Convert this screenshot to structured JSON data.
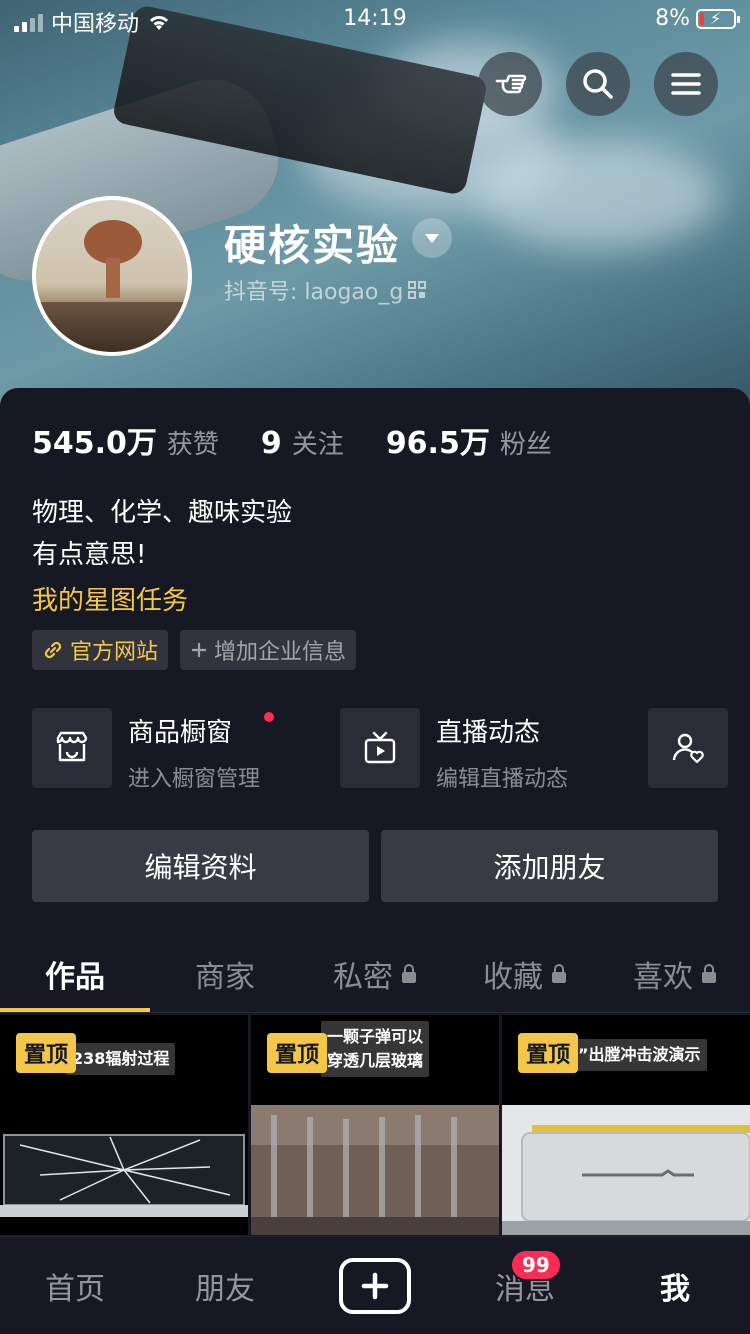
{
  "status_bar": {
    "carrier": "中国移动",
    "time": "14:19",
    "battery": "8%"
  },
  "profile": {
    "name": "硬核实验",
    "douyin_id": "抖音号: laogao_g",
    "stats": [
      {
        "num": "545.0万",
        "label": "获赞"
      },
      {
        "num": "9",
        "label": "关注"
      },
      {
        "num": "96.5万",
        "label": "粉丝"
      }
    ],
    "bio_line1": "物理、化学、趣味实验",
    "bio_line2": "有点意思!",
    "star_task": "我的星图任务",
    "tag_official": "官方网站",
    "tag_add": "增加企业信息"
  },
  "tools": [
    {
      "title": "商品橱窗",
      "sub": "进入橱窗管理"
    },
    {
      "title": "直播动态",
      "sub": "编辑直播动态"
    }
  ],
  "actions": {
    "edit": "编辑资料",
    "add_friend": "添加朋友"
  },
  "tabs": [
    "作品",
    "商家",
    "私密",
    "收藏",
    "喜欢"
  ],
  "videos": [
    {
      "pin": "置顶",
      "caption": "238辐射过程"
    },
    {
      "pin": "置顶",
      "caption_l1": "一颗子弹可以",
      "caption_l2": "穿透几层玻璃"
    },
    {
      "pin": "置顶",
      "caption": "”出膛冲击波演示"
    }
  ],
  "nav": {
    "home": "首页",
    "friends": "朋友",
    "messages": "消息",
    "me": "我",
    "badge": "99"
  },
  "colors": {
    "accent": "#f5c748",
    "badge": "#fe2c55",
    "bg": "#161823"
  }
}
